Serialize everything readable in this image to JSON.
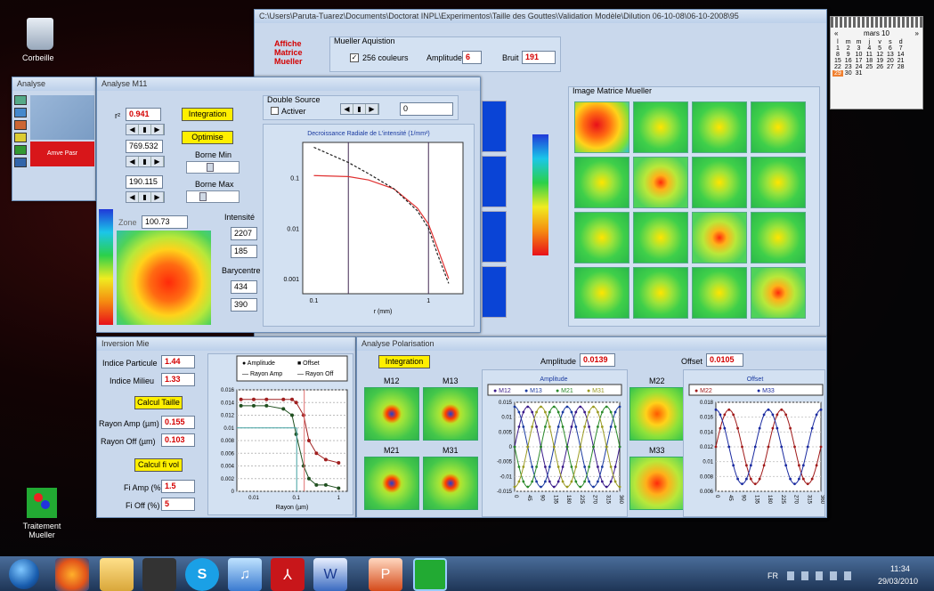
{
  "desktop": {
    "recycle_bin": "Corbeille",
    "shortcut": "Traitement Mueller"
  },
  "main_window": {
    "title": "C:\\Users\\Paruta-Tuarez\\Documents\\Doctorat INPL\\Experimentos\\Taille des Gouttes\\Validation Modèle\\Dilution 06-10-08\\06-10-2008\\95",
    "display_label": "Affiche Matrice Mueller",
    "acquisition_group": "Mueller Aquistion",
    "colors_check": "256 couleurs",
    "amplitude_label": "Amplitude",
    "amplitude_value": "6",
    "noise_label": "Bruit",
    "noise_value": "191",
    "matrix_group": "Image Matrice Mueller"
  },
  "analyse_win": {
    "title": "Analyse",
    "logo_text": "Amve Pasr"
  },
  "m11": {
    "title": "Analyse M11",
    "r_label": "r²",
    "r_value": "0.941",
    "field2": "769.532",
    "field3": "190.115",
    "integration": "Integration",
    "optimize": "Optimise",
    "borne_min": "Borne Min",
    "borne_max": "Borne Max",
    "double_source": "Double Source",
    "activate": "Activer",
    "ds_value": "0",
    "zone_label": "Zone",
    "zone_value": "100.73",
    "intensity_label": "Intensité",
    "int1": "2207",
    "int2": "185",
    "barycentre": "Barycentre",
    "bary_x": "434",
    "bary_y": "390"
  },
  "mie": {
    "title": "Inversion Mie",
    "ind_part_label": "Indice Particule",
    "ind_part": "1.44",
    "ind_milieu_label": "Indice Milieu",
    "ind_milieu": "1.33",
    "calc_size": "Calcul Taille",
    "r_amp_label": "Rayon Amp (µm)",
    "r_amp": "0.155",
    "r_off_label": "Rayon Off (µm)",
    "r_off": "0.103",
    "calc_vol": "Calcul fi vol",
    "fi_amp_label": "Fi Amp (%)",
    "fi_amp": "1.5",
    "fi_off_label": "Fi Off (%)",
    "fi_off": "5"
  },
  "polar": {
    "title": "Analyse Polarisation",
    "integration": "Integration",
    "amplitude_label": "Amplitude",
    "amplitude_value": "0.0139",
    "offset_label": "Offset",
    "offset_value": "0.0105",
    "m12": "M12",
    "m13": "M13",
    "m21": "M21",
    "m31": "M31",
    "m22": "M22",
    "m33": "M33"
  },
  "calendar": {
    "month": "mars 10",
    "days": [
      "l",
      "m",
      "m",
      "j",
      "v",
      "s",
      "d"
    ],
    "weeks": [
      [
        "1",
        "2",
        "3",
        "4",
        "5",
        "6",
        "7"
      ],
      [
        "8",
        "9",
        "10",
        "11",
        "12",
        "13",
        "14"
      ],
      [
        "15",
        "16",
        "17",
        "18",
        "19",
        "20",
        "21"
      ],
      [
        "22",
        "23",
        "24",
        "25",
        "26",
        "27",
        "28"
      ],
      [
        "29",
        "30",
        "31",
        "",
        "",
        "",
        ""
      ]
    ]
  },
  "taskbar": {
    "lang": "FR",
    "time": "11:34",
    "date": "29/03/2010"
  },
  "chart_data": [
    {
      "type": "line",
      "title": "Decroissance Radiale de  L'intensité (1/mm²)",
      "xlabel": "r (mm)",
      "x_ticks": [
        "0.1",
        "1"
      ],
      "y_ticks": [
        "0.1",
        "0.01",
        "0.001"
      ],
      "yscale": "log",
      "xscale": "log",
      "series": [
        {
          "x": [
            0.1,
            0.2,
            0.3,
            0.5,
            0.8,
            1.0,
            1.2,
            1.5
          ],
          "values": [
            0.11,
            0.105,
            0.09,
            0.06,
            0.025,
            0.012,
            0.004,
            0.001
          ]
        },
        {
          "x": [
            0.1,
            0.2,
            0.3,
            0.5,
            0.8,
            1.0,
            1.2,
            1.5
          ],
          "values": [
            0.4,
            0.2,
            0.12,
            0.06,
            0.022,
            0.01,
            0.003,
            0.0008
          ]
        }
      ]
    },
    {
      "type": "line",
      "xlabel": "Rayon (µm)",
      "legend": [
        "Amplitude",
        "Offset",
        "Rayon Amp",
        "Rayon Off"
      ],
      "x_ticks": [
        "0.01",
        "0.1",
        "1"
      ],
      "y_ticks": [
        "0.016",
        "0.014",
        "0.012",
        "0.01",
        "0.008",
        "0.006",
        "0.004",
        "0.002",
        "0"
      ],
      "ylim": [
        0,
        0.016
      ],
      "series": [
        {
          "name": "Amplitude",
          "x": [
            0.005,
            0.01,
            0.02,
            0.05,
            0.08,
            0.1,
            0.15,
            0.2,
            0.3,
            0.5,
            1
          ],
          "values": [
            0.0145,
            0.0145,
            0.0145,
            0.0145,
            0.0145,
            0.014,
            0.012,
            0.008,
            0.006,
            0.005,
            0.0045
          ]
        },
        {
          "name": "Offset",
          "x": [
            0.005,
            0.01,
            0.02,
            0.05,
            0.08,
            0.1,
            0.15,
            0.2,
            0.3,
            0.5,
            1
          ],
          "values": [
            0.0135,
            0.0135,
            0.0135,
            0.013,
            0.012,
            0.009,
            0.004,
            0.002,
            0.001,
            0.001,
            0.0005
          ]
        }
      ]
    },
    {
      "type": "line",
      "title": "Amplitude",
      "legend": [
        "M12",
        "M13",
        "M21",
        "M31"
      ],
      "y_ticks": [
        "0.015",
        "0.01",
        "0.005",
        "0",
        "-0.005",
        "-0.01",
        "-0.015"
      ],
      "x_ticks": [
        "0",
        "45",
        "90",
        "135",
        "180",
        "225",
        "270",
        "315",
        "360"
      ],
      "ylim": [
        -0.015,
        0.015
      ]
    },
    {
      "type": "line",
      "title": "Offset",
      "legend": [
        "M22",
        "M33"
      ],
      "y_ticks": [
        "0.018",
        "0.016",
        "0.014",
        "0.012",
        "0.01",
        "0.008",
        "0.006"
      ],
      "x_ticks": [
        "0",
        "45",
        "90",
        "135",
        "180",
        "225",
        "270",
        "315",
        "360"
      ],
      "ylim": [
        0.006,
        0.018
      ]
    }
  ]
}
